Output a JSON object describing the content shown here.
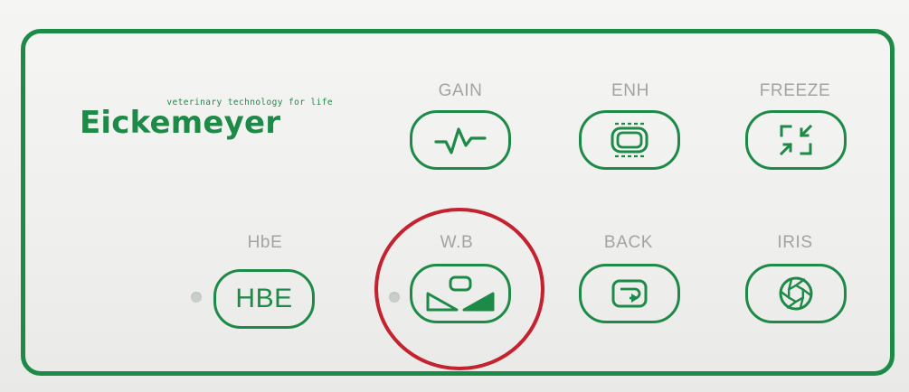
{
  "brand": {
    "name": "Eickemeyer",
    "tagline": "veterinary technology for life"
  },
  "buttons": {
    "gain": {
      "label": "GAIN",
      "icon": "waveform-icon"
    },
    "enh": {
      "label": "ENH",
      "icon": "screen-enhance-icon"
    },
    "freeze": {
      "label": "FREEZE",
      "icon": "collapse-arrows-icon"
    },
    "hbe": {
      "label": "HbE",
      "text": "HBE"
    },
    "wb": {
      "label": "W.B",
      "icon": "white-balance-icon"
    },
    "back": {
      "label": "BACK",
      "icon": "back-arrow-icon"
    },
    "iris": {
      "label": "IRIS",
      "icon": "aperture-icon"
    }
  },
  "colors": {
    "accent": "#1e8a47",
    "label_gray": "#a3a3a3",
    "highlight": "#c3222e"
  }
}
